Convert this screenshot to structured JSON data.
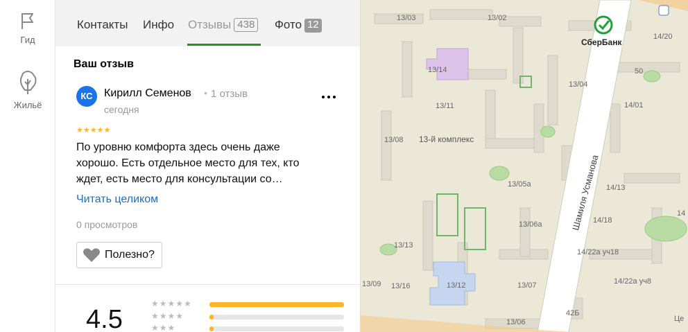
{
  "rail": {
    "guide_label": "Гид",
    "housing_label": "Жильё"
  },
  "tabs": [
    {
      "label": "Контакты"
    },
    {
      "label": "Инфо"
    },
    {
      "label": "Отзывы",
      "count": "438"
    },
    {
      "label": "Фото",
      "count": "12"
    }
  ],
  "review": {
    "section_title": "Ваш отзыв",
    "avatar_initials": "КС",
    "author": "Кирилл Семенов",
    "author_reviews": "1 отзыв",
    "date": "сегодня",
    "stars": "★★★★★",
    "rating": 5,
    "text": "По уровню комфорта здесь очень даже хорошо. Есть отдельное место для тех, кто ждет, есть место для консультации со…",
    "read_more": "Читать целиком",
    "views": "0 просмотров",
    "useful_label": "Полезно?"
  },
  "summary": {
    "rating": "4.5",
    "bars": [
      {
        "stars": "★★★★★",
        "fraction": 1.0
      },
      {
        "stars": "★★★★",
        "fraction": 0.03
      },
      {
        "stars": "★★★",
        "fraction": 0.03
      }
    ]
  },
  "map": {
    "poi": "СберБанк",
    "district": "13-й комплекс",
    "street": "Шамиля Усманова",
    "labels": [
      "13/03",
      "13/02",
      "14/20",
      "13/14",
      "50",
      "13/04",
      "14/01",
      "13/11",
      "13/08",
      "13/05а",
      "14/13",
      "14/18",
      "13/06а",
      "14",
      "13/13",
      "14/22а уч18",
      "13/09",
      "13/16",
      "13/12",
      "13/07",
      "14/22а уч8",
      "42Б",
      "13/06",
      "Це"
    ],
    "colors": {
      "ground": "#ece8d8",
      "road": "#ffffff",
      "green": "#b9dca5",
      "purple": "#ddc3ea",
      "blue": "#c7d6f0",
      "building": "#dedbce",
      "sber": "#21a038"
    }
  }
}
